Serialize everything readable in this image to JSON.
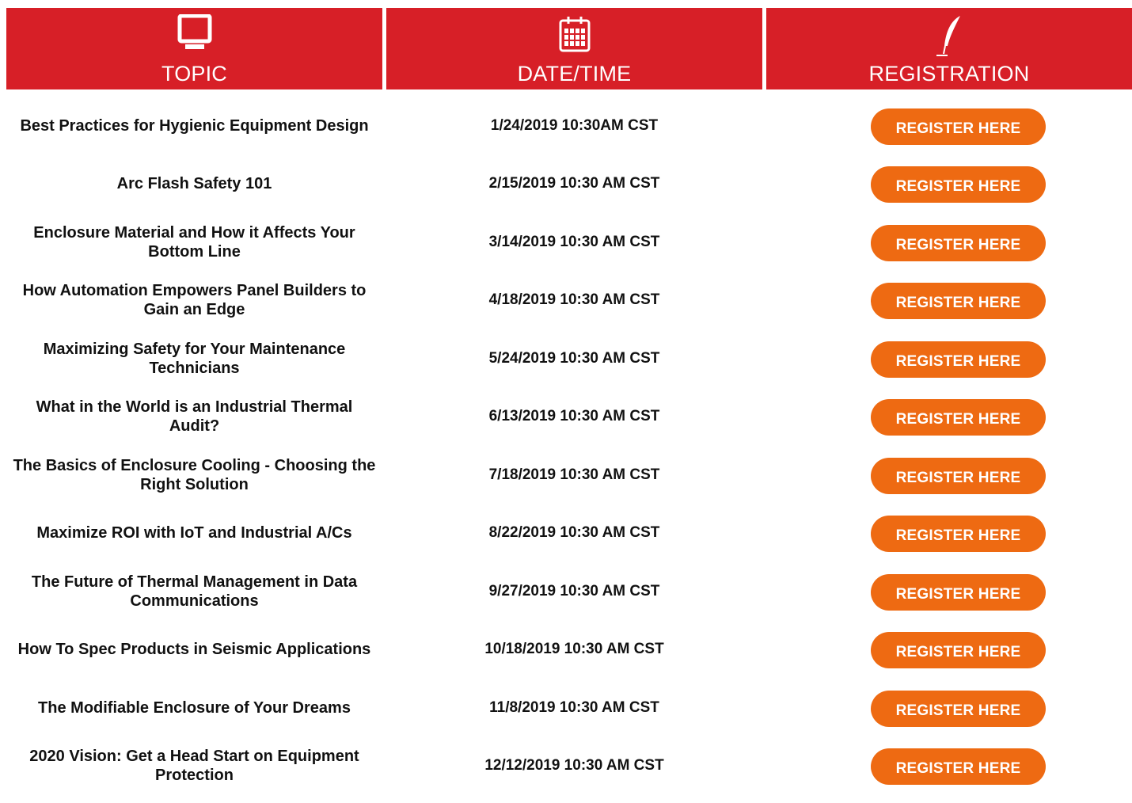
{
  "colors": {
    "header_bg": "#d71f27",
    "button_bg": "#ee6a12",
    "button_text": "#ffffff",
    "body_text": "#111111"
  },
  "header": {
    "topic": {
      "label": "TOPIC",
      "icon": "monitor-icon"
    },
    "date": {
      "label": "DATE/TIME",
      "icon": "calendar-icon"
    },
    "registration": {
      "label": "REGISTRATION",
      "icon": "quill-pen-icon"
    }
  },
  "rows": [
    {
      "topic": "Best Practices for Hygienic Equipment Design",
      "datetime": "1/24/2019 10:30AM CST",
      "button": "REGISTER HERE"
    },
    {
      "topic": "Arc Flash Safety 101",
      "datetime": "2/15/2019 10:30 AM CST",
      "button": "REGISTER HERE"
    },
    {
      "topic": "Enclosure Material and How it Affects Your Bottom Line",
      "datetime": "3/14/2019 10:30 AM CST",
      "button": "REGISTER HERE"
    },
    {
      "topic": "How Automation Empowers Panel Builders to Gain an Edge",
      "datetime": "4/18/2019 10:30 AM CST",
      "button": "REGISTER HERE"
    },
    {
      "topic": "Maximizing Safety for Your Maintenance Technicians",
      "datetime": "5/24/2019 10:30 AM CST",
      "button": "REGISTER HERE"
    },
    {
      "topic": "What in the World is an Industrial Thermal Audit?",
      "datetime": "6/13/2019 10:30 AM CST",
      "button": "REGISTER HERE"
    },
    {
      "topic": "The Basics of Enclosure Cooling - Choosing the Right Solution",
      "datetime": "7/18/2019 10:30 AM CST",
      "button": "REGISTER HERE"
    },
    {
      "topic": "Maximize ROI with IoT and Industrial A/Cs",
      "datetime": "8/22/2019 10:30 AM CST",
      "button": "REGISTER HERE"
    },
    {
      "topic": "The Future of Thermal Management in Data Communications",
      "datetime": "9/27/2019 10:30 AM CST",
      "button": "REGISTER HERE"
    },
    {
      "topic": "How To Spec Products in Seismic Applications",
      "datetime": "10/18/2019 10:30 AM CST",
      "button": "REGISTER HERE"
    },
    {
      "topic": "The Modifiable Enclosure of Your Dreams",
      "datetime": "11/8/2019 10:30 AM CST",
      "button": "REGISTER HERE"
    },
    {
      "topic": "2020 Vision: Get a Head Start on Equipment Protection",
      "datetime": "12/12/2019 10:30 AM CST",
      "button": "REGISTER HERE"
    }
  ]
}
